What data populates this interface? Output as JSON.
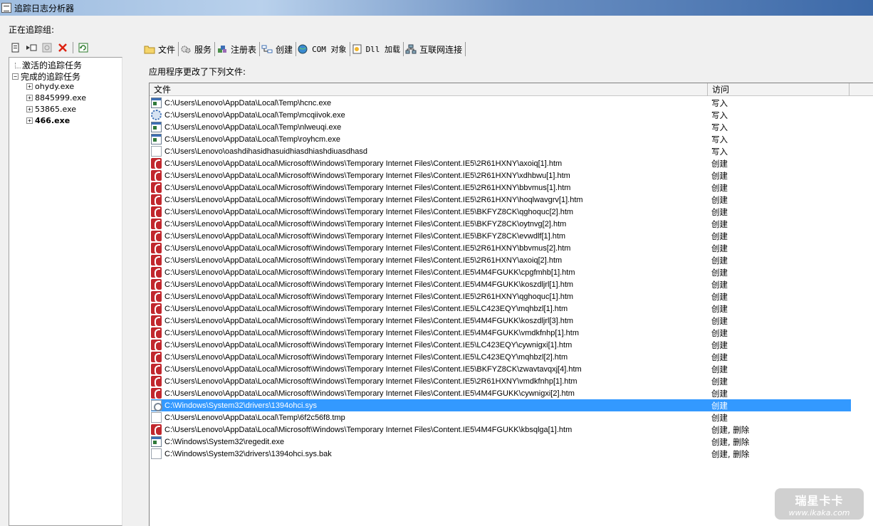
{
  "window": {
    "title": "追踪日志分析器"
  },
  "group_label": "正在追踪组:",
  "left_toolbar": [
    {
      "icon": "new-trace-icon"
    },
    {
      "icon": "start-trace-icon"
    },
    {
      "icon": "stop-trace-icon"
    },
    {
      "icon": "delete-icon"
    },
    {
      "icon": "refresh-icon"
    }
  ],
  "tree": {
    "active": "激活的追踪任务",
    "completed": "完成的追踪任务",
    "tasks": [
      "ohydy.exe",
      "8845999.exe",
      "53865.exe",
      "466.exe"
    ],
    "selected_task": "466.exe"
  },
  "tabs": [
    {
      "label": "文件",
      "icon": "folder-icon"
    },
    {
      "label": "服务",
      "icon": "service-icon"
    },
    {
      "label": "注册表",
      "icon": "registry-icon"
    },
    {
      "label": "创建",
      "icon": "create-icon"
    },
    {
      "label": "COM 对象",
      "icon": "com-icon"
    },
    {
      "label": "Dll 加载",
      "icon": "dll-icon"
    },
    {
      "label": "互联网连接",
      "icon": "network-icon"
    }
  ],
  "section_label": "应用程序更改了下列文件:",
  "columns": {
    "file": "文件",
    "access": "访问"
  },
  "rows": [
    {
      "icon": "exe",
      "file": "C:\\Users\\Lenovo\\AppData\\Local\\Temp\\hcnc.exe",
      "access": "写入"
    },
    {
      "icon": "gear",
      "file": "C:\\Users\\Lenovo\\AppData\\Local\\Temp\\mcqiivok.exe",
      "access": "写入"
    },
    {
      "icon": "exe",
      "file": "C:\\Users\\Lenovo\\AppData\\Local\\Temp\\nlweuqi.exe",
      "access": "写入"
    },
    {
      "icon": "exe",
      "file": "C:\\Users\\Lenovo\\AppData\\Local\\Temp\\royhcm.exe",
      "access": "写入"
    },
    {
      "icon": "blank",
      "file": "C:\\Users\\Lenovo\\oashdihasidhasuidhiasdhiashdiuasdhasd",
      "access": "写入"
    },
    {
      "icon": "htm",
      "file": "C:\\Users\\Lenovo\\AppData\\Local\\Microsoft\\Windows\\Temporary Internet Files\\Content.IE5\\2R61HXNY\\axoiq[1].htm",
      "access": "创建"
    },
    {
      "icon": "htm",
      "file": "C:\\Users\\Lenovo\\AppData\\Local\\Microsoft\\Windows\\Temporary Internet Files\\Content.IE5\\2R61HXNY\\xdhbwu[1].htm",
      "access": "创建"
    },
    {
      "icon": "htm",
      "file": "C:\\Users\\Lenovo\\AppData\\Local\\Microsoft\\Windows\\Temporary Internet Files\\Content.IE5\\2R61HXNY\\bbvmus[1].htm",
      "access": "创建"
    },
    {
      "icon": "htm",
      "file": "C:\\Users\\Lenovo\\AppData\\Local\\Microsoft\\Windows\\Temporary Internet Files\\Content.IE5\\2R61HXNY\\hoqlwavgrv[1].htm",
      "access": "创建"
    },
    {
      "icon": "htm",
      "file": "C:\\Users\\Lenovo\\AppData\\Local\\Microsoft\\Windows\\Temporary Internet Files\\Content.IE5\\BKFYZ8CK\\qghoquc[2].htm",
      "access": "创建"
    },
    {
      "icon": "htm",
      "file": "C:\\Users\\Lenovo\\AppData\\Local\\Microsoft\\Windows\\Temporary Internet Files\\Content.IE5\\BKFYZ8CK\\oytnvg[2].htm",
      "access": "创建"
    },
    {
      "icon": "htm",
      "file": "C:\\Users\\Lenovo\\AppData\\Local\\Microsoft\\Windows\\Temporary Internet Files\\Content.IE5\\BKFYZ8CK\\evwdlf[1].htm",
      "access": "创建"
    },
    {
      "icon": "htm",
      "file": "C:\\Users\\Lenovo\\AppData\\Local\\Microsoft\\Windows\\Temporary Internet Files\\Content.IE5\\2R61HXNY\\bbvmus[2].htm",
      "access": "创建"
    },
    {
      "icon": "htm",
      "file": "C:\\Users\\Lenovo\\AppData\\Local\\Microsoft\\Windows\\Temporary Internet Files\\Content.IE5\\2R61HXNY\\axoiq[2].htm",
      "access": "创建"
    },
    {
      "icon": "htm",
      "file": "C:\\Users\\Lenovo\\AppData\\Local\\Microsoft\\Windows\\Temporary Internet Files\\Content.IE5\\4M4FGUKK\\cpgfmhb[1].htm",
      "access": "创建"
    },
    {
      "icon": "htm",
      "file": "C:\\Users\\Lenovo\\AppData\\Local\\Microsoft\\Windows\\Temporary Internet Files\\Content.IE5\\4M4FGUKK\\koszdljrl[1].htm",
      "access": "创建"
    },
    {
      "icon": "htm",
      "file": "C:\\Users\\Lenovo\\AppData\\Local\\Microsoft\\Windows\\Temporary Internet Files\\Content.IE5\\2R61HXNY\\qghoquc[1].htm",
      "access": "创建"
    },
    {
      "icon": "htm",
      "file": "C:\\Users\\Lenovo\\AppData\\Local\\Microsoft\\Windows\\Temporary Internet Files\\Content.IE5\\LC423EQY\\mqhbzl[1].htm",
      "access": "创建"
    },
    {
      "icon": "htm",
      "file": "C:\\Users\\Lenovo\\AppData\\Local\\Microsoft\\Windows\\Temporary Internet Files\\Content.IE5\\4M4FGUKK\\koszdljrl[3].htm",
      "access": "创建"
    },
    {
      "icon": "htm",
      "file": "C:\\Users\\Lenovo\\AppData\\Local\\Microsoft\\Windows\\Temporary Internet Files\\Content.IE5\\4M4FGUKK\\vmdkfnhp[1].htm",
      "access": "创建"
    },
    {
      "icon": "htm",
      "file": "C:\\Users\\Lenovo\\AppData\\Local\\Microsoft\\Windows\\Temporary Internet Files\\Content.IE5\\LC423EQY\\cywnigxi[1].htm",
      "access": "创建"
    },
    {
      "icon": "htm",
      "file": "C:\\Users\\Lenovo\\AppData\\Local\\Microsoft\\Windows\\Temporary Internet Files\\Content.IE5\\LC423EQY\\mqhbzl[2].htm",
      "access": "创建"
    },
    {
      "icon": "htm",
      "file": "C:\\Users\\Lenovo\\AppData\\Local\\Microsoft\\Windows\\Temporary Internet Files\\Content.IE5\\BKFYZ8CK\\zwavtavqxj[4].htm",
      "access": "创建"
    },
    {
      "icon": "htm",
      "file": "C:\\Users\\Lenovo\\AppData\\Local\\Microsoft\\Windows\\Temporary Internet Files\\Content.IE5\\2R61HXNY\\vmdkfnhp[1].htm",
      "access": "创建"
    },
    {
      "icon": "htm",
      "file": "C:\\Users\\Lenovo\\AppData\\Local\\Microsoft\\Windows\\Temporary Internet Files\\Content.IE5\\4M4FGUKK\\cywnigxi[2].htm",
      "access": "创建"
    },
    {
      "icon": "sys",
      "file": "C:\\Windows\\System32\\drivers\\1394ohci.sys",
      "access": "创建",
      "selected": true
    },
    {
      "icon": "blank",
      "file": "C:\\Users\\Lenovo\\AppData\\Local\\Temp\\6f2c56f8.tmp",
      "access": "创建"
    },
    {
      "icon": "htm",
      "file": "C:\\Users\\Lenovo\\AppData\\Local\\Microsoft\\Windows\\Temporary Internet Files\\Content.IE5\\4M4FGUKK\\kbsqlga[1].htm",
      "access": "创建, 删除"
    },
    {
      "icon": "exe",
      "file": "C:\\Windows\\System32\\regedit.exe",
      "access": "创建, 删除"
    },
    {
      "icon": "blank",
      "file": "C:\\Windows\\System32\\drivers\\1394ohci.sys.bak",
      "access": "创建, 删除"
    }
  ],
  "watermark": {
    "line1": "瑞星卡卡",
    "line2": "www.ikaka.com"
  },
  "colors": {
    "selection": "#3399ff",
    "htm_icon": "#c1272d"
  }
}
